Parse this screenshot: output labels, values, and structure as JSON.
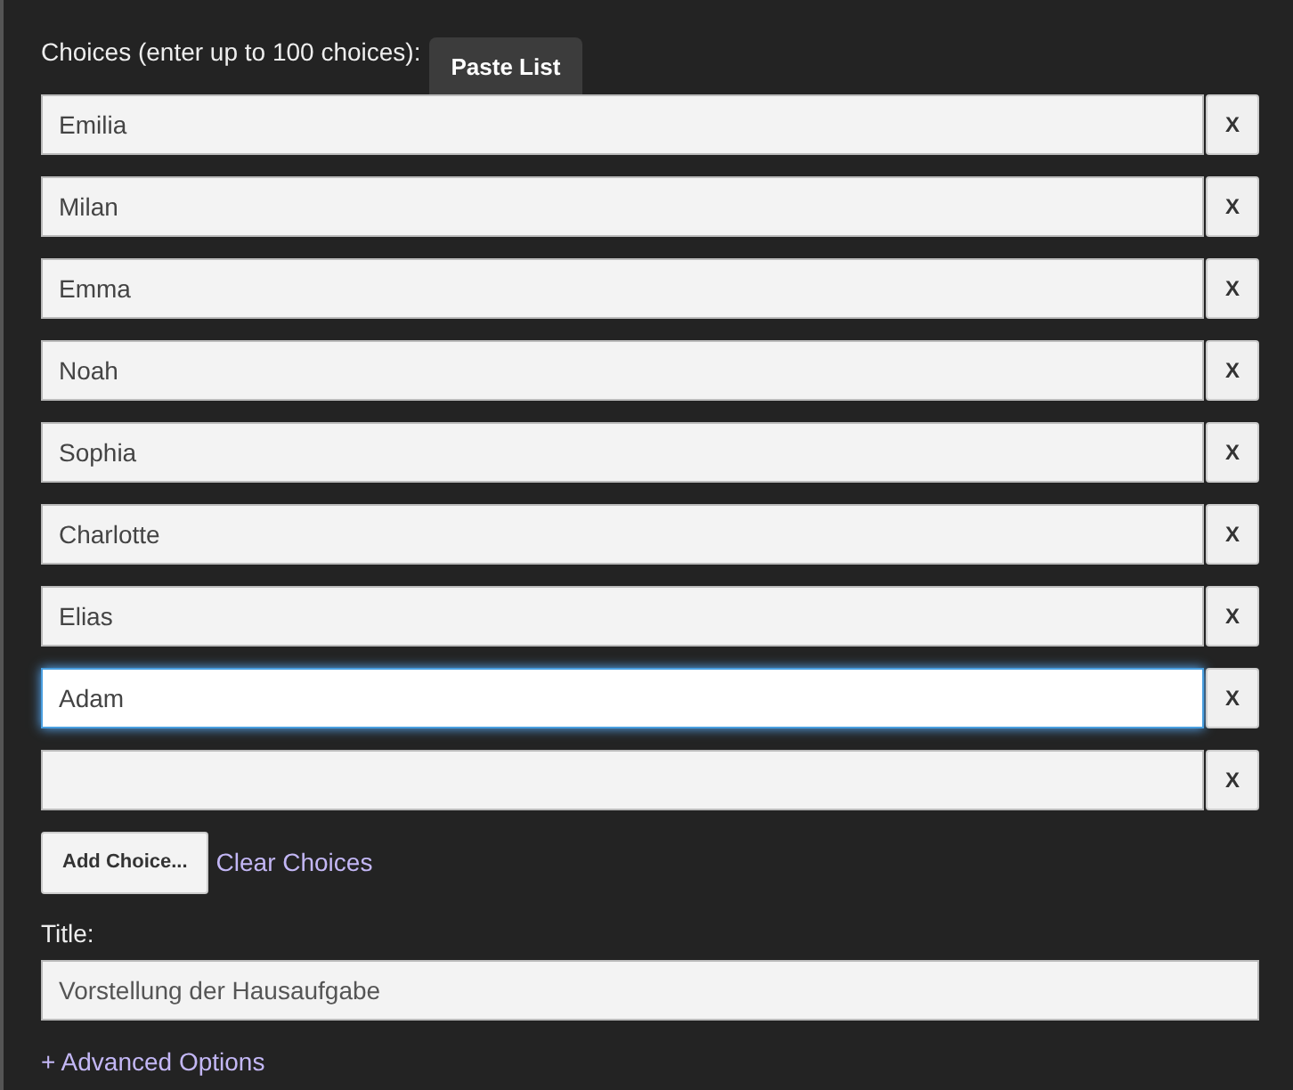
{
  "choices_label": "Choices (enter up to 100 choices):",
  "paste_button": "Paste List",
  "choices": [
    {
      "value": "Emilia",
      "focused": false,
      "remove": "X"
    },
    {
      "value": "Milan",
      "focused": false,
      "remove": "X"
    },
    {
      "value": "Emma",
      "focused": false,
      "remove": "X"
    },
    {
      "value": "Noah",
      "focused": false,
      "remove": "X"
    },
    {
      "value": "Sophia",
      "focused": false,
      "remove": "X"
    },
    {
      "value": "Charlotte",
      "focused": false,
      "remove": "X"
    },
    {
      "value": "Elias",
      "focused": false,
      "remove": "X"
    },
    {
      "value": "Adam",
      "focused": true,
      "remove": "X"
    },
    {
      "focused": false,
      "remove": "X"
    }
  ],
  "add_button": "Add Choice...",
  "clear_link": "Clear Choices",
  "title_label": "Title:",
  "title_value": "Vorstellung der Hausaufgabe",
  "advanced_link": "+ Advanced Options"
}
